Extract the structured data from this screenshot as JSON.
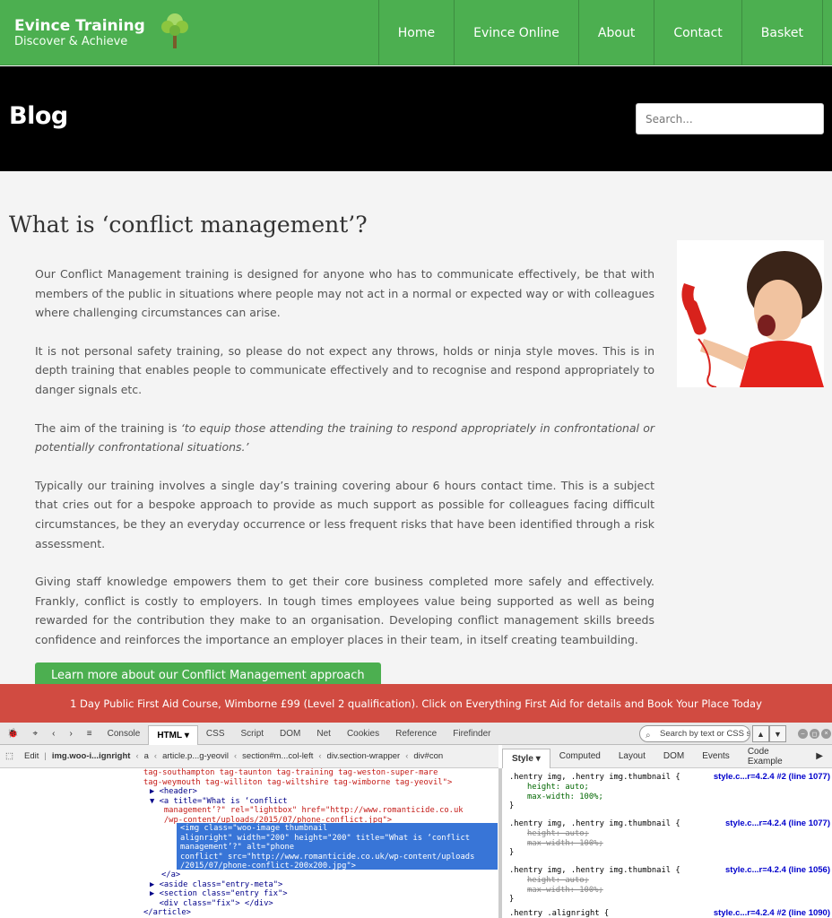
{
  "header": {
    "brand_title": "Evince Training",
    "brand_tagline": "Discover & Achieve",
    "logo_icon": "tree-icon",
    "nav": [
      "Home",
      "Evince Online",
      "About",
      "Contact",
      "Basket"
    ],
    "colors": {
      "header_green": "#4caf50",
      "title_band": "#000000",
      "promo_red": "#d14b41"
    }
  },
  "titleband": {
    "page_title": "Blog",
    "search_placeholder": "Search..."
  },
  "post": {
    "title": "What is ‘conflict management’?",
    "p1": "Our Conflict Management training is designed for anyone who has to communicate effectively, be that with members of the public in situations where people may not act in a normal or expected way or with colleagues where challenging circumstances can arise.",
    "p2": "It is not personal safety training, so please do not expect any throws, holds or ninja style moves.  This is in depth training that enables people to communicate effectively and to recognise and respond appropriately to danger signals etc.",
    "p3_lead": "The aim of the training is ",
    "p3_quote": "‘to equip those attending the training to respond appropriately in confrontational or potentially confrontational situations.’",
    "p4": "Typically our training involves a single day’s training covering abour 6 hours contact time.  This is a subject that cries out for a bespoke approach to provide as much support as possible for colleagues facing difficult circumstances, be they an everyday occurrence or less frequent risks that have been identified through a risk assessment.",
    "p5": "Giving staff knowledge empowers them to get their core business completed more safely and effectively.  Frankly, conflict is costly to employers.  In tough times employees value being supported as well as being rewarded for the contribution they make to an organisation.  Developing conflict management skills breeds confidence and reinforces the importance an employer places in their team, in itself creating teambuilding.",
    "cta": "Learn more about our Conflict Management approach"
  },
  "promo": {
    "text": "1 Day Public First Aid Course, Wimborne £99 (Level 2 qualification). Click on Everything First Aid for details and Book Your Place Today"
  },
  "devtools": {
    "tabs": [
      "Console",
      "HTML",
      "CSS",
      "Script",
      "DOM",
      "Net",
      "Cookies",
      "Reference",
      "Firefinder"
    ],
    "search_placeholder": "Search by text or CSS s",
    "edit": "Edit",
    "crumbs": [
      "img.woo-i...ignright",
      "a",
      "article.p...g-yeovil",
      "section#m...col-left",
      "div.section-wrapper",
      "div#con"
    ],
    "right_tabs": [
      "Style",
      "Computed",
      "Layout",
      "DOM",
      "Events",
      "Code Example"
    ],
    "html_lines": [
      "tag-southampton tag-taunton tag-training tag-weston-super-mare",
      "tag-weymouth tag-williton tag-wiltshire tag-wimborne tag-yeovil\">",
      "▶ <header>",
      "▼ <a title=\"What is ‘conflict",
      "   management’?\" rel=\"lightbox\" href=\"http://www.romanticide.co.uk",
      "   /wp-content/uploads/2015/07/phone-conflict.jpg\">",
      "</a>",
      "▶ <aside class=\"entry-meta\">",
      "▶ <section class=\"entry fix\">",
      "  <div class=\"fix\"> </div>",
      "</article>"
    ],
    "selected_block": "<img class=\"woo-image thumbnail\nalignright\" width=\"200\" height=\"200\" title=\"What is ‘conflict\nmanagement’?\" alt=\"phone\nconflict\" src=\"http://www.romanticide.co.uk/wp-content/uploads\n/2015/07/phone-conflict-200x200.jpg\">",
    "css_rules": [
      {
        "selector": ".hentry img, .hentry img.thumbnail {",
        "source": "style.c...r=4.2.4 #2 (line 1077)",
        "props": [
          "height: auto;",
          "max-width: 100%;"
        ],
        "strike": [
          false,
          false
        ]
      },
      {
        "selector": ".hentry img, .hentry img.thumbnail {",
        "source": "style.c...r=4.2.4 (line 1077)",
        "props": [
          "height: auto;",
          "max-width: 100%;"
        ],
        "strike": [
          true,
          true
        ]
      },
      {
        "selector": ".hentry img, .hentry img.thumbnail {",
        "source": "style.c...r=4.2.4 (line 1056)",
        "props": [
          "height: auto;",
          "max-width: 100%;"
        ],
        "strike": [
          true,
          true
        ]
      },
      {
        "selector": ".hentry .alignright {",
        "source": "style.c...r=4.2.4 #2 (line 1090)",
        "props": [],
        "strike": []
      }
    ]
  }
}
